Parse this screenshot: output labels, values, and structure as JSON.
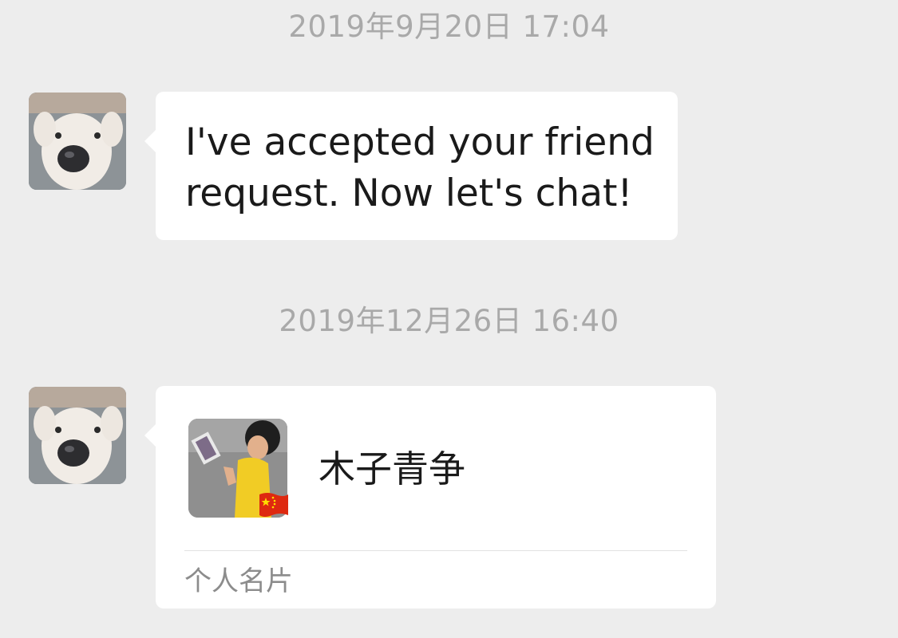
{
  "chat": {
    "messages": [
      {
        "timestamp": "2019年9月20日 17:04",
        "type": "text",
        "text": "I've accepted your friend request. Now let's chat!"
      },
      {
        "timestamp": "2019年12月26日 16:40",
        "type": "contact_card",
        "card": {
          "name": "木子青争",
          "label": "个人名片"
        }
      }
    ]
  },
  "colors": {
    "background": "#ededed",
    "bubble": "#ffffff",
    "timestamp_text": "#a9a9a9",
    "message_text": "#1a1a1a"
  },
  "icons": {
    "sender_avatar": "white-dog-avatar",
    "contact_photo": "child-photo-avatar",
    "contact_badge": "china-flag-icon"
  }
}
